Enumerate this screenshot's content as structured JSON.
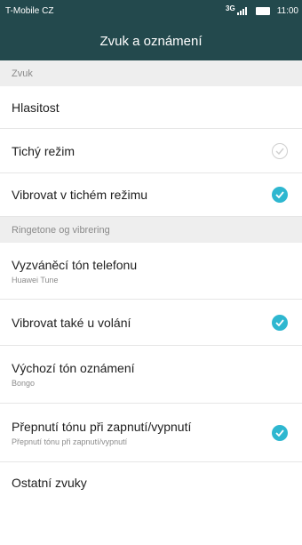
{
  "status_bar": {
    "carrier": "T-Mobile CZ",
    "network_type": "3G",
    "time": "11:00"
  },
  "header": {
    "title": "Zvuk a oznámení"
  },
  "sections": [
    {
      "header": "Zvuk",
      "rows": [
        {
          "title": "Hlasitost",
          "subtitle": ""
        },
        {
          "title": "Tichý režim",
          "subtitle": "",
          "checked": false
        },
        {
          "title": "Vibrovat v tichém režimu",
          "subtitle": "",
          "checked": true
        }
      ]
    },
    {
      "header": "Ringetone og vibrering",
      "rows": [
        {
          "title": "Vyzváněcí tón telefonu",
          "subtitle": "Huawei Tune"
        },
        {
          "title": "Vibrovat také u volání",
          "subtitle": "",
          "checked": true
        },
        {
          "title": "Výchozí tón oznámení",
          "subtitle": "Bongo"
        },
        {
          "title": "Přepnutí tónu při zapnutí/vypnutí",
          "subtitle": "Přepnutí tónu při zapnutí/vypnutí",
          "checked": true
        },
        {
          "title": "Ostatní zvuky",
          "subtitle": ""
        }
      ]
    }
  ],
  "colors": {
    "header_bg": "#23494d",
    "accent": "#2eb7d0",
    "section_bg": "#eeeeee"
  },
  "icons": {
    "checked": "check-circle-filled-icon",
    "unchecked": "check-circle-outline-icon",
    "signal": "signal-icon",
    "battery": "battery-icon"
  }
}
